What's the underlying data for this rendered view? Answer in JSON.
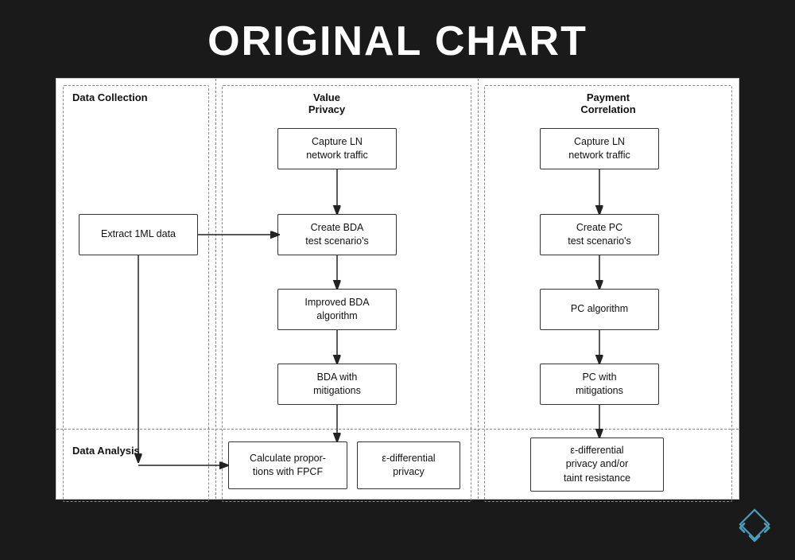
{
  "title": "ORIGINAL CHART",
  "chart": {
    "sections": {
      "data_collection_label": "Data\nCollection",
      "value_privacy_label": "Value\nPrivacy",
      "payment_correlation_label": "Payment\nCorrelation",
      "data_analysis_label": "Data Analysis"
    },
    "boxes": {
      "capture_ln_vp": "Capture LN\nnetwork traffic",
      "create_bda": "Create BDA\ntest scenario's",
      "extract_1ml": "Extract 1ML data",
      "improved_bda": "Improved BDA\nalgorithm",
      "bda_mitigations": "BDA with\nmitigations",
      "capture_ln_pc": "Capture LN\nnetwork traffic",
      "create_pc": "Create PC\ntest scenario's",
      "pc_algorithm": "PC algorithm",
      "pc_mitigations": "PC with\nmitigations",
      "calc_proportions": "Calculate propor-\ntions with FPCF",
      "epsilon_dp_vp": "ε-differential\nprivacy",
      "epsilon_dp_pc": "ε-differential\nprivacy and/or\ntaint resistance"
    }
  }
}
